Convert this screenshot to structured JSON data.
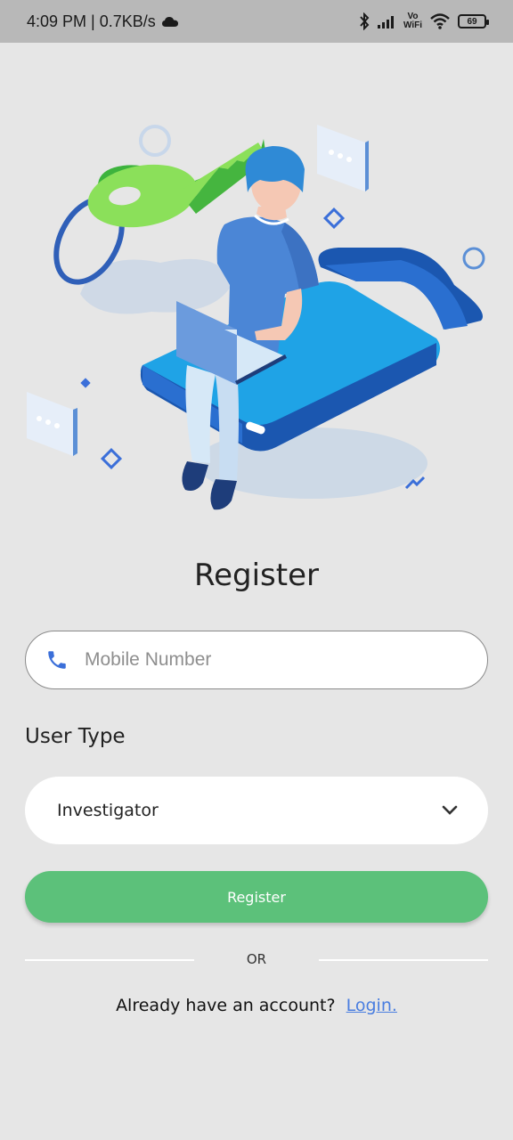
{
  "status_bar": {
    "time_speed": "4:09 PM | 0.7KB/s",
    "vowifi_top": "Vo",
    "vowifi_bottom": "WiFi",
    "battery": "69"
  },
  "page": {
    "title": "Register"
  },
  "mobile": {
    "placeholder": "Mobile Number",
    "value": ""
  },
  "user_type": {
    "label": "User Type",
    "selected": "Investigator"
  },
  "actions": {
    "register_label": "Register",
    "or_label": "OR",
    "login_prompt": "Already have an account?",
    "login_link": "Login."
  },
  "colors": {
    "accent_green": "#5cc17a",
    "link_blue": "#4a7ee0",
    "phone_icon": "#3b6fd9"
  },
  "icons": [
    "cloud-icon",
    "bluetooth-icon",
    "signal-icon",
    "wifi-icon",
    "battery-icon",
    "phone-icon",
    "chevron-down-icon"
  ]
}
